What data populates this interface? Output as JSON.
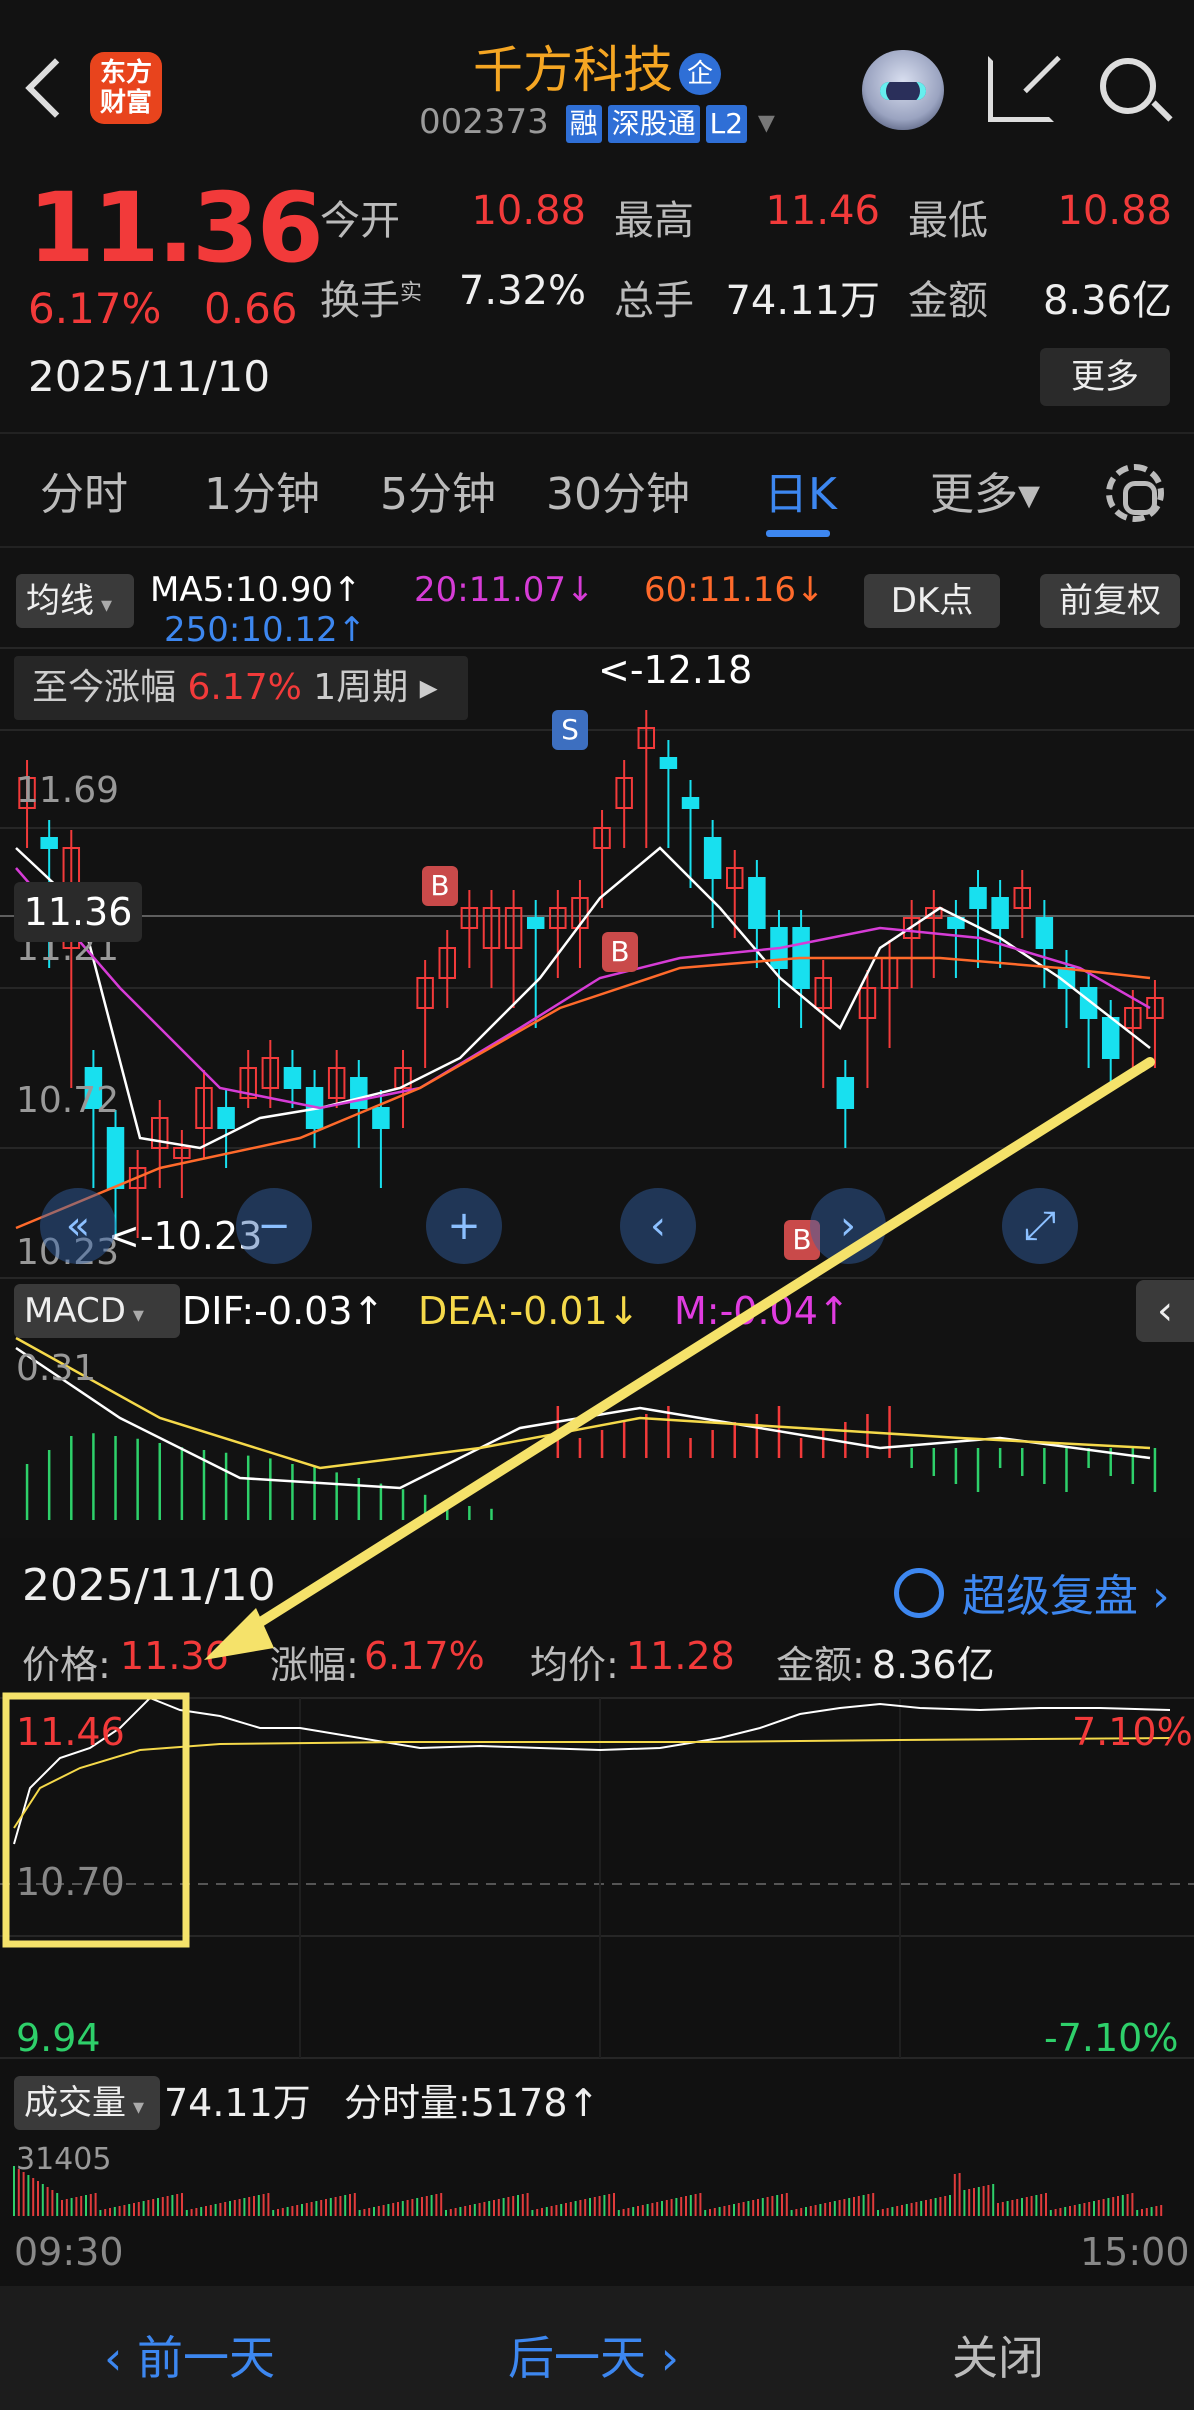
{
  "header": {
    "logo_line1": "东方",
    "logo_line2": "财富",
    "title": "千方科技",
    "title_badge": "企",
    "code": "002373",
    "tags": [
      "融",
      "深股通",
      "L2"
    ],
    "tag_caret": "▾"
  },
  "quote": {
    "price": "11.36",
    "pct": "6.17%",
    "change": "0.66",
    "date": "2025/11/10",
    "fields": [
      {
        "label": "今开",
        "value": "10.88"
      },
      {
        "label": "最高",
        "value": "11.46"
      },
      {
        "label": "最低",
        "value": "10.88"
      },
      {
        "label": "换手",
        "sup": "实",
        "value": "7.32%"
      },
      {
        "label": "总手",
        "value": "74.11万"
      },
      {
        "label": "金额",
        "value": "8.36亿"
      }
    ],
    "more": "更多"
  },
  "tabs": [
    "分时",
    "1分钟",
    "5分钟",
    "30分钟",
    "日K",
    "更多▾"
  ],
  "kline": {
    "ma_btn": "均线",
    "ma5": "MA5:10.90↑",
    "ma20": "20:11.07↓",
    "ma60": "60:11.16↓",
    "ma250": "250:10.12↑",
    "dk_btn": "DK点",
    "fq_btn": "前复权",
    "period_label": "至今涨幅",
    "period_pct": "6.17%",
    "period_cycle": "1周期 ▸",
    "high_mark": "<-12.18",
    "low_mark": "<-10.23",
    "y_ticks": [
      "11.69",
      "11.21",
      "10.72",
      "10.23"
    ],
    "price_tag": "11.36",
    "marker_s": "S",
    "marker_b": "B",
    "ctrl_icons": [
      "«",
      "−",
      "+",
      "‹",
      "›",
      "⤢"
    ],
    "colors": {
      "up": "#f23a3a",
      "down": "#18e0ef",
      "ma5": "#ffffff",
      "ma20": "#d63cd6",
      "ma60": "#ff6a2b",
      "ma250": "#3d87f0"
    }
  },
  "macd": {
    "btn": "MACD",
    "dif": "DIF:-0.03↑",
    "dea": "DEA:-0.01↓",
    "m": "M:-0.04↑",
    "tick": "0.31",
    "collapse": "‹"
  },
  "review": {
    "date": "2025/11/10",
    "brand": "超级复盘 ›",
    "price_label": "价格:",
    "price_value": "11.36",
    "pct_label": "涨幅:",
    "pct_value": "6.17%",
    "avg_label": "均价:",
    "avg_value": "11.28",
    "amt_label": "金额:",
    "amt_value": "8.36亿",
    "top_left": "11.46",
    "mid_left": "10.70",
    "bottom_left": "9.94",
    "top_right": "7.10%",
    "bottom_right": "-7.10%",
    "vol_btn": "成交量",
    "vol_total": "74.11万",
    "vol_min": "分时量:5178↑",
    "vol_tick": "31405",
    "time_start": "09:30",
    "time_end": "15:00"
  },
  "footer": {
    "prev": "‹ 前一天",
    "next": "后一天 ›",
    "close": "关闭"
  }
}
